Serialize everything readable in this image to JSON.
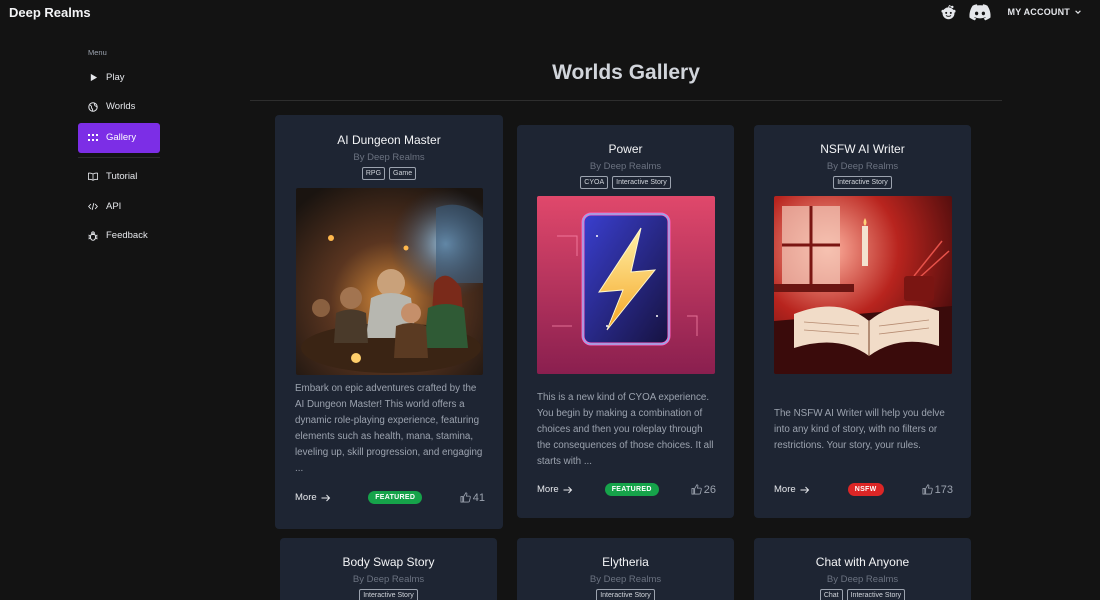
{
  "app": {
    "brand": "Deep Realms"
  },
  "header": {
    "account_label": "MY ACCOUNT"
  },
  "sidebar": {
    "menu_label": "Menu",
    "items": [
      {
        "label": "Play",
        "icon": "play-icon"
      },
      {
        "label": "Worlds",
        "icon": "globe-icon"
      },
      {
        "label": "Gallery",
        "icon": "grid-icon",
        "active": true
      },
      {
        "label": "Tutorial",
        "icon": "book-icon"
      },
      {
        "label": "API",
        "icon": "code-icon"
      },
      {
        "label": "Feedback",
        "icon": "bug-icon"
      }
    ]
  },
  "main": {
    "title": "Worlds Gallery",
    "cards": [
      {
        "title": "AI Dungeon Master",
        "author": "By Deep Realms",
        "tags": [
          "RPG",
          "Game"
        ],
        "description": "Embark on epic adventures crafted by the AI Dungeon Master! This world offers a dynamic role-playing experience, featuring elements such as health, mana, stamina, leveling up, skill progression, and engaging ...",
        "more_label": "More",
        "badge": "FEATURED",
        "likes": "41"
      },
      {
        "title": "Power",
        "author": "By Deep Realms",
        "tags": [
          "CYOA",
          "Interactive Story"
        ],
        "description": "This is a new kind of CYOA experience. You begin by making a combination of choices and then you roleplay through the consequences of those choices. It all starts with ...",
        "more_label": "More",
        "badge": "FEATURED",
        "likes": "26"
      },
      {
        "title": "NSFW AI Writer",
        "author": "By Deep Realms",
        "tags": [
          "Interactive Story"
        ],
        "description": "The NSFW AI Writer will help you delve into any kind of story, with no filters or restrictions. Your story, your rules.",
        "more_label": "More",
        "badge": "NSFW",
        "likes": "173"
      },
      {
        "title": "Body Swap Story",
        "author": "By Deep Realms",
        "tags": [
          "Interactive Story"
        ]
      },
      {
        "title": "Elytheria",
        "author": "By Deep Realms",
        "tags": [
          "Interactive Story"
        ]
      },
      {
        "title": "Chat with Anyone",
        "author": "By Deep Realms",
        "tags": [
          "Chat",
          "Interactive Story"
        ]
      }
    ]
  },
  "colors": {
    "background": "#131313",
    "card": "#1e2533",
    "accent": "#7c2ee6",
    "featured": "#16a34a",
    "nsfw": "#dc2626"
  }
}
